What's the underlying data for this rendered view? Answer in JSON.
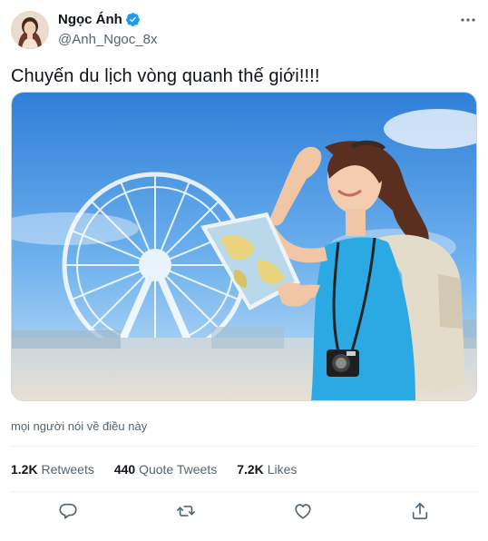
{
  "user": {
    "name": "Ngọc Ánh",
    "handle": "@Anh_Ngoc_8x",
    "verified": true
  },
  "tweet": {
    "text": "Chuyến du lịch vòng quanh thế giới!!!!"
  },
  "social_context": "mọi người nói về điều này",
  "stats": {
    "retweets": {
      "count": "1.2K",
      "label": "Retweets"
    },
    "quotes": {
      "count": "440",
      "label": "Quote Tweets"
    },
    "likes": {
      "count": "7.2K",
      "label": "Likes"
    }
  },
  "actions": [
    "reply-icon",
    "retweet-icon",
    "like-icon",
    "share-icon"
  ],
  "colors": {
    "text": "#0f1419",
    "secondary": "#536471",
    "verified": "#1d9bf0",
    "divider": "#eff3f4",
    "sky": "#3d8fe0"
  }
}
